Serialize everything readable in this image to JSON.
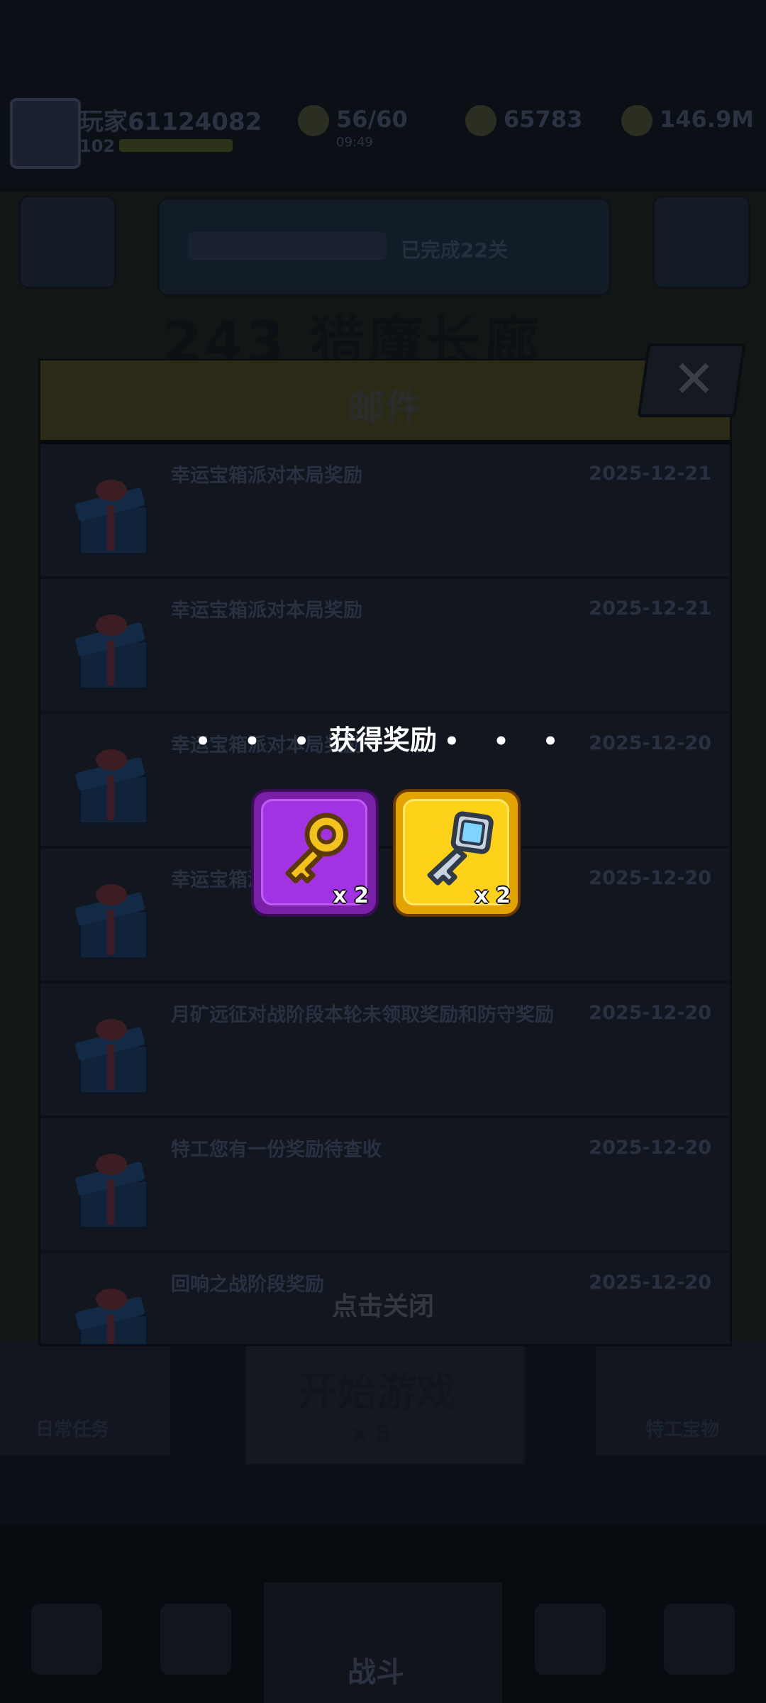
{
  "background": {
    "player": {
      "name": "玩家61124082",
      "level": "102"
    },
    "resources": {
      "stamina": "56/60",
      "stamina_sub": "09:49",
      "gold": "65783",
      "gems": "146.9M"
    },
    "event": {
      "sub_label": "已完成22关"
    },
    "stage_title": "243 猎魔长廊",
    "bottom": {
      "left_label": "日常任务",
      "start_label": "开始游戏",
      "start_cost": "x 5",
      "right_label": "特工宝物"
    },
    "nav": {
      "center_label": "战斗"
    }
  },
  "mail_dialog": {
    "title": "邮件",
    "close_icon": "close-x-icon",
    "items": [
      {
        "subject": "幸运宝箱派对本局奖励",
        "date": "2025-12-21",
        "icon": "gift-icon"
      },
      {
        "subject": "幸运宝箱派对本局奖励",
        "date": "2025-12-21",
        "icon": "gift-icon"
      },
      {
        "subject": "幸运宝箱派对本局奖励",
        "date": "2025-12-20",
        "icon": "gift-icon"
      },
      {
        "subject": "幸运宝箱派对本局奖励",
        "date": "2025-12-20",
        "icon": "gift-icon"
      },
      {
        "subject": "月矿远征对战阶段本轮未领取奖励和防守奖励",
        "date": "2025-12-20",
        "icon": "gift-icon"
      },
      {
        "subject": "特工您有一份奖励待查收",
        "date": "2025-12-20",
        "icon": "gift-icon"
      },
      {
        "subject": "回响之战阶段奖励",
        "date": "2025-12-20",
        "icon": "gift-icon"
      }
    ],
    "tap_to_close": "点击关闭"
  },
  "reward_popup": {
    "title": "获得奖励",
    "title_dots": "• • •",
    "items": [
      {
        "name": "gold-key-icon",
        "quantity": "x 2",
        "frame_color": "#a233e3"
      },
      {
        "name": "crystal-key-icon",
        "quantity": "x 2",
        "frame_color": "#ffd21a"
      }
    ]
  }
}
